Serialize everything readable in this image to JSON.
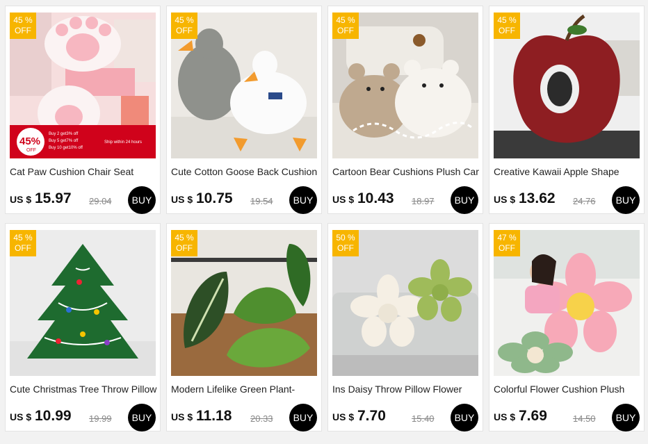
{
  "products": [
    {
      "discount": "45 %",
      "off": "OFF",
      "title": "Cat Paw Cushion Chair Seat",
      "currency": "US $",
      "price": "15.97",
      "original": "29.04",
      "buy": "BUY",
      "promo": {
        "pct": "45%",
        "off": "OFF",
        "lines": [
          "Buy 2 get3% off",
          "Buy 5 get7% off",
          "Buy 10 get10% off"
        ],
        "ship": "Ship within 24 hours"
      }
    },
    {
      "discount": "45 %",
      "off": "OFF",
      "title": "Cute Cotton Goose Back Cushion",
      "currency": "US $",
      "price": "10.75",
      "original": "19.54",
      "buy": "BUY"
    },
    {
      "discount": "45 %",
      "off": "OFF",
      "title": "Cartoon Bear Cushions Plush Car",
      "currency": "US $",
      "price": "10.43",
      "original": "18.97",
      "buy": "BUY"
    },
    {
      "discount": "45 %",
      "off": "OFF",
      "title": "Creative Kawaii Apple Shape",
      "currency": "US $",
      "price": "13.62",
      "original": "24.76",
      "buy": "BUY"
    },
    {
      "discount": "45 %",
      "off": "OFF",
      "title": "Cute Christmas Tree Throw Pillow",
      "currency": "US $",
      "price": "10.99",
      "original": "19.99",
      "buy": "BUY"
    },
    {
      "discount": "45 %",
      "off": "OFF",
      "title": "Modern Lifelike Green Plant-",
      "currency": "US $",
      "price": "11.18",
      "original": "20.33",
      "buy": "BUY"
    },
    {
      "discount": "50 %",
      "off": "OFF",
      "title": "Ins Daisy Throw Pillow Flower",
      "currency": "US $",
      "price": "7.70",
      "original": "15.40",
      "buy": "BUY"
    },
    {
      "discount": "47 %",
      "off": "OFF",
      "title": "Colorful Flower Cushion Plush",
      "currency": "US $",
      "price": "7.69",
      "original": "14.50",
      "buy": "BUY"
    }
  ],
  "colors": {
    "badge": "#f7b500",
    "buy": "#000000",
    "promo": "#d0021b"
  }
}
